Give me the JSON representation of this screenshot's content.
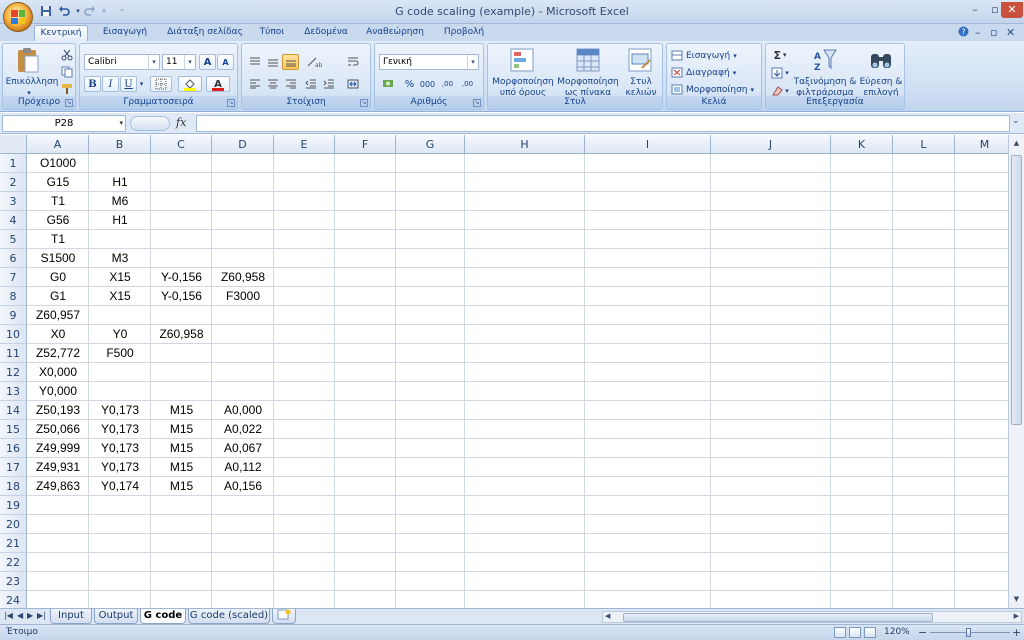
{
  "window": {
    "title": "G code scaling (example) - Microsoft Excel"
  },
  "qat": {
    "save_icon": "save-icon",
    "undo_icon": "undo-icon",
    "redo_icon": "redo-icon"
  },
  "tabs": [
    "Κεντρική",
    "Εισαγωγή",
    "Διάταξη σελίδας",
    "Τύποι",
    "Δεδομένα",
    "Αναθεώρηση",
    "Προβολή"
  ],
  "ribbon": {
    "clipboard": {
      "label": "Πρόχειρο",
      "paste": "Επικόλληση"
    },
    "font": {
      "label": "Γραμματοσειρά",
      "name": "Calibri",
      "size": "11",
      "bold": "B",
      "italic": "I",
      "underline": "U",
      "grow": "A",
      "shrink": "A"
    },
    "alignment": {
      "label": "Στοίχιση"
    },
    "number": {
      "label": "Αριθμός",
      "format": "Γενική",
      "percent": "%",
      "thousands": "000",
      "inc_dec": ",00",
      "dec_dec": ",00"
    },
    "styles": {
      "label": "Στυλ",
      "conditional": [
        "Μορφοποίηση",
        "υπό όρους"
      ],
      "as_table": [
        "Μορφοποίηση",
        "ως πίνακα"
      ],
      "cell_styles": [
        "Στυλ",
        "κελιών"
      ]
    },
    "cells": {
      "label": "Κελιά",
      "insert": "Εισαγωγή",
      "delete": "Διαγραφή",
      "format": "Μορφοποίηση"
    },
    "editing": {
      "label": "Επεξεργασία",
      "sort": [
        "Ταξινόμηση &",
        "φιλτράρισμα"
      ],
      "find": [
        "Εύρεση &",
        "επιλογή"
      ]
    }
  },
  "formula_bar": {
    "name_box": "P28",
    "fx": "fx",
    "value": ""
  },
  "columns": [
    "A",
    "B",
    "C",
    "D",
    "E",
    "F",
    "G",
    "H",
    "I",
    "J",
    "K",
    "L",
    "M"
  ],
  "rows": [
    "1",
    "2",
    "3",
    "4",
    "5",
    "6",
    "7",
    "8",
    "9",
    "10",
    "11",
    "12",
    "13",
    "14",
    "15",
    "16",
    "17",
    "18",
    "19",
    "20",
    "21",
    "22",
    "23",
    "24"
  ],
  "cells": [
    [
      "O1000",
      "",
      "",
      ""
    ],
    [
      "G15",
      "H1",
      "",
      ""
    ],
    [
      "T1",
      "M6",
      "",
      ""
    ],
    [
      "G56",
      "H1",
      "",
      ""
    ],
    [
      "T1",
      "",
      "",
      ""
    ],
    [
      "S1500",
      "M3",
      "",
      ""
    ],
    [
      "G0",
      "X15",
      "Y-0,156",
      "Z60,958"
    ],
    [
      "G1",
      "X15",
      "Y-0,156",
      "F3000"
    ],
    [
      "Z60,957",
      "",
      "",
      ""
    ],
    [
      "X0",
      "Y0",
      "Z60,958",
      ""
    ],
    [
      "Z52,772",
      "F500",
      "",
      ""
    ],
    [
      "X0,000",
      "",
      "",
      ""
    ],
    [
      "Y0,000",
      "",
      "",
      ""
    ],
    [
      "Z50,193",
      "Y0,173",
      "M15",
      "A0,000"
    ],
    [
      "Z50,066",
      "Y0,173",
      "M15",
      "A0,022"
    ],
    [
      "Z49,999",
      "Y0,173",
      "M15",
      "A0,067"
    ],
    [
      "Z49,931",
      "Y0,173",
      "M15",
      "A0,112"
    ],
    [
      "Z49,863",
      "Y0,174",
      "M15",
      "A0,156"
    ]
  ],
  "sheets": [
    "Input",
    "Output",
    "G code",
    "G code (scaled)"
  ],
  "active_sheet": "G code",
  "status": {
    "text": "Έτοιμο",
    "zoom": "120%"
  }
}
